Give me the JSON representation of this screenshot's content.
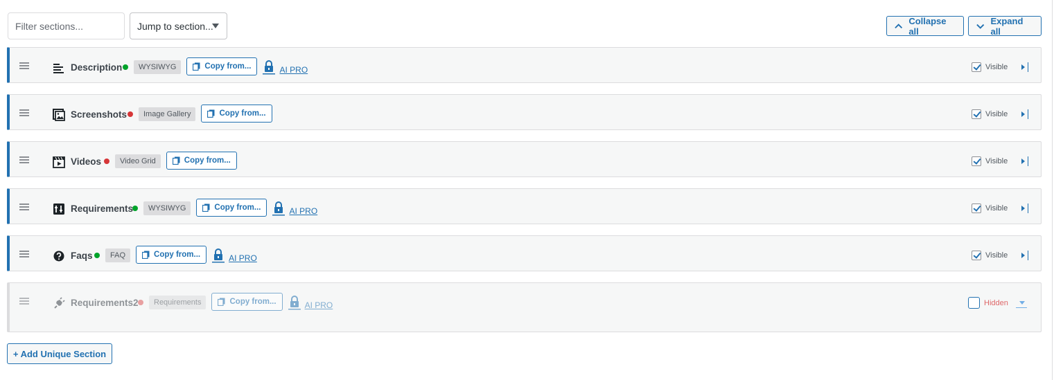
{
  "toolbar": {
    "filter_placeholder": "Filter sections...",
    "jump_label": "Jump to section...",
    "collapse_all": "Collapse all",
    "expand_all": "Expand all"
  },
  "colors": {
    "accent": "#2271b1",
    "status_active": "#00a32a",
    "status_inactive": "#d63638"
  },
  "sections": [
    {
      "title": "Description",
      "icon": "text-align-left-icon",
      "status": "active",
      "tag": "WYSIWYG",
      "copy_label": "Copy from...",
      "ai_label": "AI PRO",
      "visibility_label": "Visible",
      "visible": true
    },
    {
      "title": "Screenshots",
      "icon": "image-gallery-icon",
      "status": "inactive",
      "tag": "Image Gallery",
      "copy_label": "Copy from...",
      "ai_label": "",
      "visibility_label": "Visible",
      "visible": true
    },
    {
      "title": "Videos",
      "icon": "video-icon",
      "status": "inactive",
      "tag": "Video Grid",
      "copy_label": "Copy from...",
      "ai_label": "",
      "visibility_label": "Visible",
      "visible": true
    },
    {
      "title": "Requirements",
      "icon": "requirements-icon",
      "status": "active",
      "tag": "WYSIWYG",
      "copy_label": "Copy from...",
      "ai_label": "AI PRO",
      "visibility_label": "Visible",
      "visible": true
    },
    {
      "title": "Faqs",
      "icon": "question-icon",
      "status": "active",
      "tag": "FAQ",
      "copy_label": "Copy from...",
      "ai_label": "AI PRO",
      "visibility_label": "Visible",
      "visible": true
    },
    {
      "title": "Requirements2",
      "icon": "plugin-icon",
      "status": "inactive",
      "tag": "Requirements",
      "copy_label": "Copy from...",
      "ai_label": "AI PRO",
      "visibility_label": "Hidden",
      "visible": false
    }
  ],
  "add_button": "+ Add Unique Section"
}
